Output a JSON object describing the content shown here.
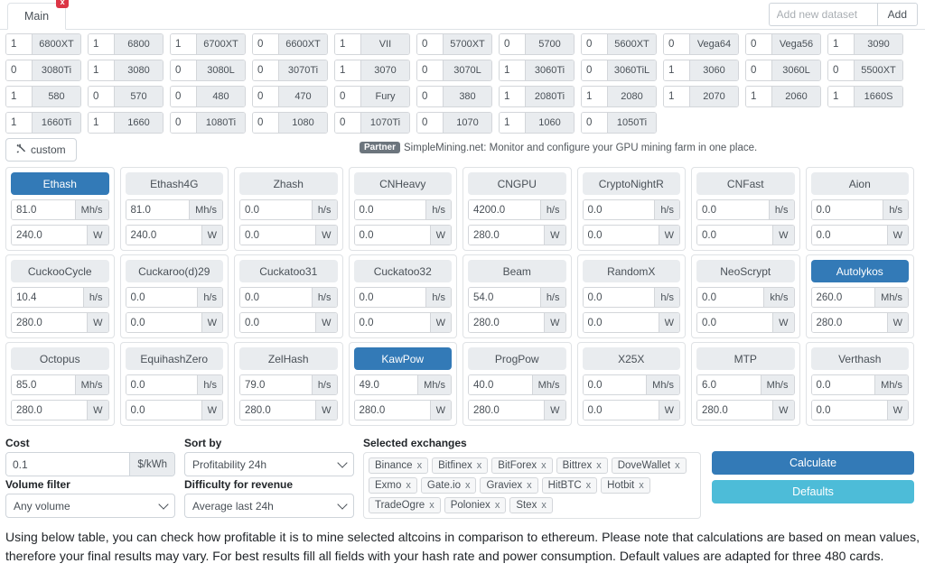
{
  "tabbar": {
    "tab_label": "Main",
    "close_label": "x",
    "dataset_placeholder": "Add new dataset",
    "dataset_value": "",
    "add_label": "Add"
  },
  "gpu_rows": [
    [
      {
        "qty": "1",
        "name": "6800XT"
      },
      {
        "qty": "1",
        "name": "6800"
      },
      {
        "qty": "1",
        "name": "6700XT"
      },
      {
        "qty": "0",
        "name": "6600XT"
      },
      {
        "qty": "1",
        "name": "VII"
      },
      {
        "qty": "0",
        "name": "5700XT"
      },
      {
        "qty": "0",
        "name": "5700"
      },
      {
        "qty": "0",
        "name": "5600XT"
      },
      {
        "qty": "0",
        "name": "Vega64"
      },
      {
        "qty": "0",
        "name": "Vega56"
      },
      {
        "qty": "1",
        "name": "3090"
      }
    ],
    [
      {
        "qty": "0",
        "name": "3080Ti"
      },
      {
        "qty": "1",
        "name": "3080"
      },
      {
        "qty": "0",
        "name": "3080L"
      },
      {
        "qty": "0",
        "name": "3070Ti"
      },
      {
        "qty": "1",
        "name": "3070"
      },
      {
        "qty": "0",
        "name": "3070L"
      },
      {
        "qty": "1",
        "name": "3060Ti"
      },
      {
        "qty": "0",
        "name": "3060TiL"
      },
      {
        "qty": "1",
        "name": "3060"
      },
      {
        "qty": "0",
        "name": "3060L"
      },
      {
        "qty": "0",
        "name": "5500XT"
      }
    ],
    [
      {
        "qty": "1",
        "name": "580"
      },
      {
        "qty": "0",
        "name": "570"
      },
      {
        "qty": "0",
        "name": "480"
      },
      {
        "qty": "0",
        "name": "470"
      },
      {
        "qty": "0",
        "name": "Fury"
      },
      {
        "qty": "0",
        "name": "380"
      },
      {
        "qty": "1",
        "name": "2080Ti"
      },
      {
        "qty": "1",
        "name": "2080"
      },
      {
        "qty": "1",
        "name": "2070"
      },
      {
        "qty": "1",
        "name": "2060"
      },
      {
        "qty": "1",
        "name": "1660S"
      }
    ],
    [
      {
        "qty": "1",
        "name": "1660Ti"
      },
      {
        "qty": "1",
        "name": "1660"
      },
      {
        "qty": "0",
        "name": "1080Ti"
      },
      {
        "qty": "0",
        "name": "1080"
      },
      {
        "qty": "0",
        "name": "1070Ti"
      },
      {
        "qty": "0",
        "name": "1070"
      },
      {
        "qty": "1",
        "name": "1060"
      },
      {
        "qty": "0",
        "name": "1050Ti"
      }
    ]
  ],
  "custom": {
    "button_label": "custom",
    "partner_badge": "Partner",
    "partner_text": "SimpleMining.net: Monitor and configure your GPU mining farm in one place."
  },
  "algos": [
    [
      {
        "name": "Ethash",
        "active": true,
        "rate": "81.0",
        "rate_unit": "Mh/s",
        "power": "240.0",
        "power_unit": "W"
      },
      {
        "name": "Ethash4G",
        "active": false,
        "rate": "81.0",
        "rate_unit": "Mh/s",
        "power": "240.0",
        "power_unit": "W"
      },
      {
        "name": "Zhash",
        "active": false,
        "rate": "0.0",
        "rate_unit": "h/s",
        "power": "0.0",
        "power_unit": "W"
      },
      {
        "name": "CNHeavy",
        "active": false,
        "rate": "0.0",
        "rate_unit": "h/s",
        "power": "0.0",
        "power_unit": "W"
      },
      {
        "name": "CNGPU",
        "active": false,
        "rate": "4200.0",
        "rate_unit": "h/s",
        "power": "280.0",
        "power_unit": "W"
      },
      {
        "name": "CryptoNightR",
        "active": false,
        "rate": "0.0",
        "rate_unit": "h/s",
        "power": "0.0",
        "power_unit": "W"
      },
      {
        "name": "CNFast",
        "active": false,
        "rate": "0.0",
        "rate_unit": "h/s",
        "power": "0.0",
        "power_unit": "W"
      },
      {
        "name": "Aion",
        "active": false,
        "rate": "0.0",
        "rate_unit": "h/s",
        "power": "0.0",
        "power_unit": "W"
      }
    ],
    [
      {
        "name": "CuckooCycle",
        "active": false,
        "rate": "10.4",
        "rate_unit": "h/s",
        "power": "280.0",
        "power_unit": "W"
      },
      {
        "name": "Cuckaroo(d)29",
        "active": false,
        "rate": "0.0",
        "rate_unit": "h/s",
        "power": "0.0",
        "power_unit": "W"
      },
      {
        "name": "Cuckatoo31",
        "active": false,
        "rate": "0.0",
        "rate_unit": "h/s",
        "power": "0.0",
        "power_unit": "W"
      },
      {
        "name": "Cuckatoo32",
        "active": false,
        "rate": "0.0",
        "rate_unit": "h/s",
        "power": "0.0",
        "power_unit": "W"
      },
      {
        "name": "Beam",
        "active": false,
        "rate": "54.0",
        "rate_unit": "h/s",
        "power": "280.0",
        "power_unit": "W"
      },
      {
        "name": "RandomX",
        "active": false,
        "rate": "0.0",
        "rate_unit": "h/s",
        "power": "0.0",
        "power_unit": "W"
      },
      {
        "name": "NeoScrypt",
        "active": false,
        "rate": "0.0",
        "rate_unit": "kh/s",
        "power": "0.0",
        "power_unit": "W"
      },
      {
        "name": "Autolykos",
        "active": true,
        "rate": "260.0",
        "rate_unit": "Mh/s",
        "power": "280.0",
        "power_unit": "W"
      }
    ],
    [
      {
        "name": "Octopus",
        "active": false,
        "rate": "85.0",
        "rate_unit": "Mh/s",
        "power": "280.0",
        "power_unit": "W"
      },
      {
        "name": "EquihashZero",
        "active": false,
        "rate": "0.0",
        "rate_unit": "h/s",
        "power": "0.0",
        "power_unit": "W"
      },
      {
        "name": "ZelHash",
        "active": false,
        "rate": "79.0",
        "rate_unit": "h/s",
        "power": "280.0",
        "power_unit": "W"
      },
      {
        "name": "KawPow",
        "active": true,
        "rate": "49.0",
        "rate_unit": "Mh/s",
        "power": "280.0",
        "power_unit": "W"
      },
      {
        "name": "ProgPow",
        "active": false,
        "rate": "40.0",
        "rate_unit": "Mh/s",
        "power": "280.0",
        "power_unit": "W"
      },
      {
        "name": "X25X",
        "active": false,
        "rate": "0.0",
        "rate_unit": "Mh/s",
        "power": "0.0",
        "power_unit": "W"
      },
      {
        "name": "MTP",
        "active": false,
        "rate": "6.0",
        "rate_unit": "Mh/s",
        "power": "280.0",
        "power_unit": "W"
      },
      {
        "name": "Verthash",
        "active": false,
        "rate": "0.0",
        "rate_unit": "Mh/s",
        "power": "0.0",
        "power_unit": "W"
      }
    ]
  ],
  "controls": {
    "cost_label": "Cost",
    "cost_value": "0.1",
    "cost_unit": "$/kWh",
    "volume_label": "Volume filter",
    "volume_value": "Any volume",
    "sort_label": "Sort by",
    "sort_value": "Profitability 24h",
    "difficulty_label": "Difficulty for revenue",
    "difficulty_value": "Average last 24h",
    "exchanges_label": "Selected exchanges",
    "exchanges": [
      "Binance",
      "Bitfinex",
      "BitForex",
      "Bittrex",
      "DoveWallet",
      "Exmo",
      "Gate.io",
      "Graviex",
      "HitBTC",
      "Hotbit",
      "TradeOgre",
      "Poloniex",
      "Stex"
    ],
    "chip_remove": "x",
    "calculate_label": "Calculate",
    "defaults_label": "Defaults"
  },
  "footer": {
    "text": "Using below table, you can check how profitable it is to mine selected altcoins in comparison to ethereum. Please note that calculations are based on mean values, therefore your final results may vary. For best results fill all fields with your hash rate and power consumption. Default values are adapted for three 480 cards."
  },
  "colors": {
    "accent_blue": "#337ab7",
    "defaults_cyan": "#4dbcd8",
    "close_red": "#dc3545",
    "muted_gray": "#e9ecef"
  }
}
